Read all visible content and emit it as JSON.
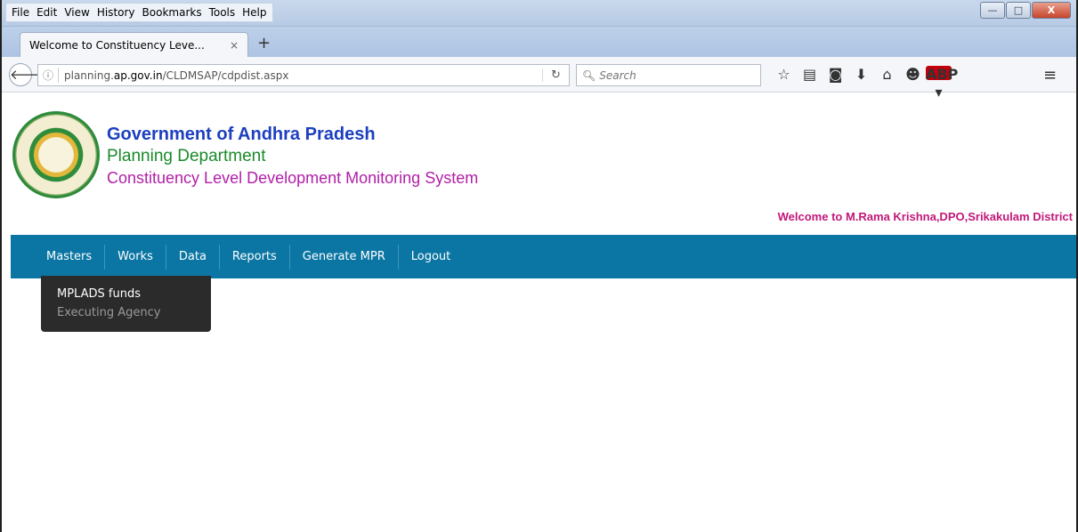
{
  "browser": {
    "menu": [
      "File",
      "Edit",
      "View",
      "History",
      "Bookmarks",
      "Tools",
      "Help"
    ],
    "window_controls": {
      "minimize": "—",
      "maximize": "□",
      "close": "X"
    },
    "tab": {
      "title": "Welcome to Constituency Leve...",
      "close": "×"
    },
    "new_tab": "+",
    "url_prefix": "planning.",
    "url_domain": "ap.gov.in",
    "url_path": "/CLDMSAP/cdpdist.aspx",
    "search_placeholder": "Search",
    "icons": [
      "star-icon",
      "reading-list-icon",
      "pocket-icon",
      "download-icon",
      "home-icon",
      "emoji-icon",
      "adblock-icon",
      "menu-icon"
    ],
    "abp_label": "ABP"
  },
  "header": {
    "title": "Government of Andhra Pradesh",
    "department": "Planning Department",
    "system": "Constituency Level Development Monitoring System",
    "welcome": "Welcome to M.Rama Krishna,DPO,Srikakulam District"
  },
  "nav": {
    "items": [
      "Masters",
      "Works",
      "Data",
      "Reports",
      "Generate MPR",
      "Logout"
    ]
  },
  "dropdown": {
    "items": [
      "MPLADS funds",
      "Executing Agency"
    ]
  },
  "colors": {
    "nav_bg": "#0b76a3",
    "title_blue": "#1d3fbf",
    "dept_green": "#1a8a2a",
    "system_purple": "#b220a8",
    "welcome_pink": "#c2187a",
    "dropdown_bg": "#2b2b2b"
  }
}
